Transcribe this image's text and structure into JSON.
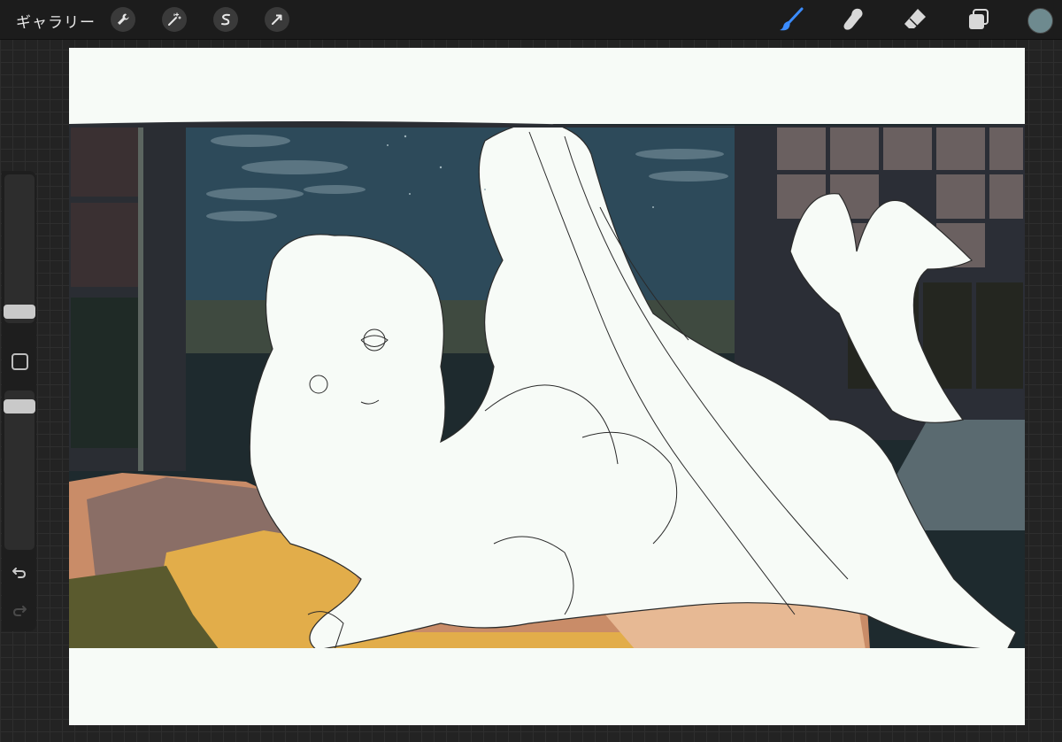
{
  "toolbar": {
    "gallery_label": "ギャラリー",
    "left_tools": [
      "wrench-icon",
      "magic-wand-icon",
      "selection-icon",
      "transform-arrow-icon"
    ],
    "right_tools": [
      "brush-icon",
      "smudge-icon",
      "eraser-icon",
      "layers-icon"
    ],
    "active_tool": "brush-icon",
    "current_color": "#6e8a8f",
    "active_tool_color": "#3b8cff"
  },
  "sidebar": {
    "brush_size": 0.3,
    "opacity": 0.95,
    "icons": [
      "modify-square-icon",
      "undo-icon",
      "redo-icon"
    ]
  },
  "canvas": {
    "description_colors": {
      "paper": "#f7fbf7",
      "night_sky": "#2d4a5a",
      "window_frame": "#2a2d33",
      "pillow_gold": "#e2ad4a",
      "sheet_tan": "#c98c68",
      "blanket_olive": "#5a5a2e"
    }
  }
}
